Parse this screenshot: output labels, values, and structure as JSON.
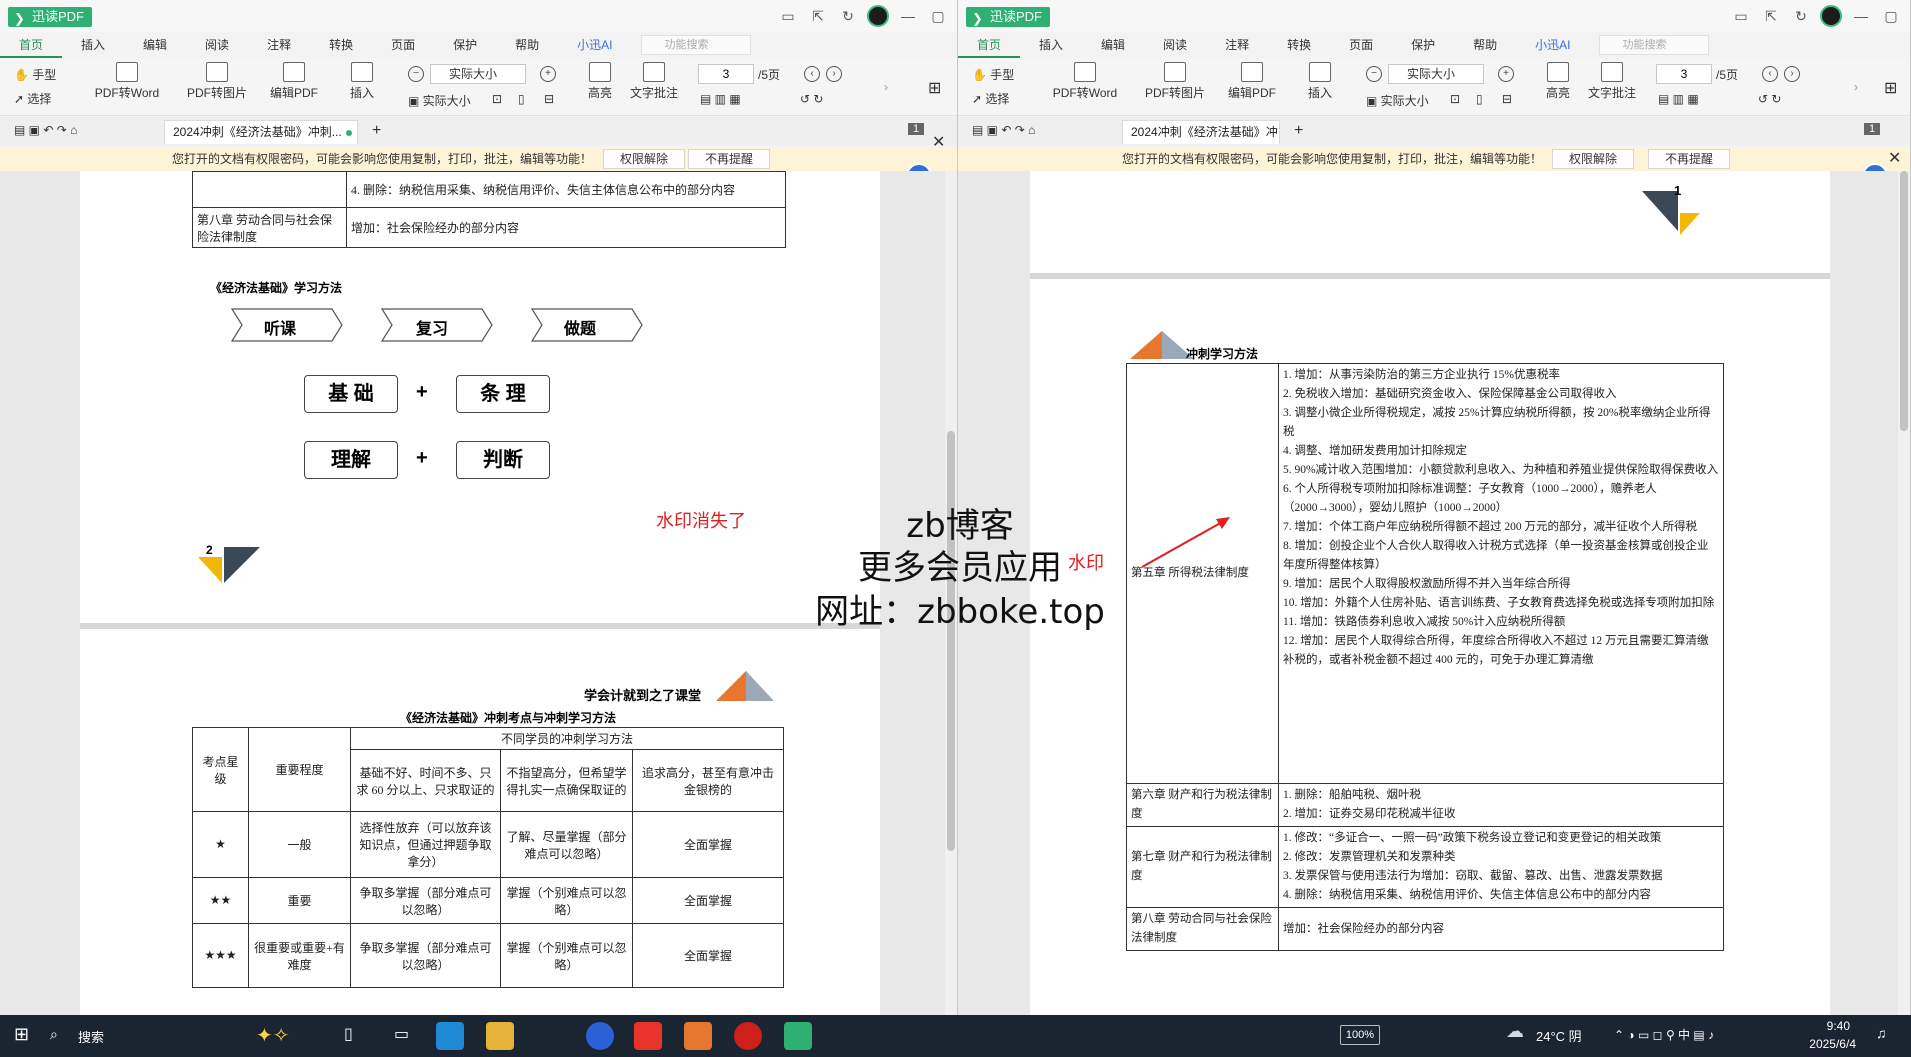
{
  "app": {
    "name": "迅读PDF",
    "menus": [
      "首页",
      "插入",
      "编辑",
      "阅读",
      "注释",
      "转换",
      "页面",
      "保护",
      "帮助",
      "小迅AI"
    ],
    "search_placeholder": "功能搜索"
  },
  "ribbon": {
    "hand": "手型",
    "select": "选择",
    "pdf_to_word": "PDF转Word",
    "pdf_to_image": "PDF转图片",
    "edit_pdf": "编辑PDF",
    "insert": "插入",
    "zoom_value": "实际大小",
    "actual_size": "实际大小",
    "highlight": "高亮",
    "text_annot": "文字批注",
    "page_current": "3",
    "page_total": "/5页"
  },
  "tab": {
    "title": "2024冲刺《经济法基础》冲刺..."
  },
  "notice": {
    "text": "您打开的文档有权限密码，可能会影响您使用复制，打印，批注，编辑等功能！",
    "unlock": "权限解除",
    "dismiss": "不再提醒"
  },
  "left_doc": {
    "chapter8_name": "第八章 劳动合同与社会保险法律制度",
    "chapter8_content": "增加：社会保险经办的部分内容",
    "prev_row_text": "4. 删除：纳税信用采集、纳税信用评价、失信主体信息公布中的部分内容",
    "methods_title": "《经济法基础》学习方法",
    "steps": [
      "听课",
      "复习",
      "做题"
    ],
    "box1a": "基 础",
    "box1b": "条 理",
    "box2a": "理解",
    "box2b": "判断",
    "plus": "+",
    "note": "水印消失了",
    "page_num": "2",
    "brand_line": "学会计就到之了课堂",
    "table_title": "《经济法基础》冲刺考点与冲刺学习方法",
    "table": {
      "h_star": "考点星级",
      "h_importance": "重要程度",
      "h_group": "不同学员的冲刺学习方法",
      "h_col1": "基础不好、时间不多、只求 60 分以上、只求取证的",
      "h_col2": "不指望高分，但希望学得扎实一点确保取证的",
      "h_col3": "追求高分，甚至有意冲击金银榜的",
      "rows": [
        {
          "star": "★",
          "level": "一般",
          "c1": "选择性放弃（可以放弃该知识点，但通过押题争取拿分）",
          "c2": "了解、尽量掌握（部分难点可以忽略）",
          "c3": "全面掌握"
        },
        {
          "star": "★★",
          "level": "重要",
          "c1": "争取多掌握（部分难点可以忽略）",
          "c2": "掌握（个别难点可以忽略）",
          "c3": "全面掌握"
        },
        {
          "star": "★★★",
          "level": "很重要或重要+有难度",
          "c1": "争取多掌握（部分难点可以忽略）",
          "c2": "掌握（个别难点可以忽略）",
          "c3": "全面掌握"
        }
      ]
    }
  },
  "right_doc": {
    "page_num": "1",
    "section_title": "冲刺学习方法",
    "watermark_label": "水印",
    "chapter5_name": "第五章 所得税法律制度",
    "chapter5_items": [
      "1. 增加：从事污染防治的第三方企业执行 15%优惠税率",
      "2. 免税收入增加：基础研究资金收入、保险保障基金公司取得收入",
      "3. 调整小微企业所得税规定，减按 25%计算应纳税所得额，按 20%税率缴纳企业所得税",
      "4. 调整、增加研发费用加计扣除规定",
      "5. 90%减计收入范围增加：小额贷款利息收入、为种植和养殖业提供保险取得保费收入",
      "6. 个人所得税专项附加扣除标准调整：子女教育（1000→2000），赡养老人（2000→3000），婴幼儿照护（1000→2000）",
      "7. 增加：个体工商户年应纳税所得额不超过 200 万元的部分，减半征收个人所得税",
      "8. 增加：创投企业个人合伙人取得收入计税方式选择（单一投资基金核算或创投企业年度所得整体核算）",
      "9. 增加：居民个人取得股权激励所得不并入当年综合所得",
      "10. 增加：外籍个人住房补贴、语言训练费、子女教育费选择免税或选择专项附加扣除",
      "11. 增加：铁路债券利息收入减按 50%计入应纳税所得额",
      "12. 增加：居民个人取得综合所得，年度综合所得收入不超过 12 万元且需要汇算清缴补税的，或者补税金额不超过 400 元的，可免于办理汇算清缴"
    ],
    "chapter6_name": "第六章 财产和行为税法律制度",
    "chapter6_items": [
      "1. 删除：船舶吨税、烟叶税",
      "2. 增加：证券交易印花税减半征收"
    ],
    "chapter7_name": "第七章 财产和行为税法律制度",
    "chapter7_items": [
      "1. 修改：“多证合一、一照一码”政策下税务设立登记和变更登记的相关政策",
      "2. 修改：发票管理机关和发票种类",
      "3. 发票保管与使用违法行为增加：窃取、截留、篡改、出售、泄露发票数据",
      "4. 删除：纳税信用采集、纳税信用评价、失信主体信息公布中的部分内容"
    ],
    "chapter8_name": "第八章 劳动合同与社会保险法律制度",
    "chapter8_content": "增加：社会保险经办的部分内容"
  },
  "overlay": {
    "line1": "zb博客",
    "line2": "更多会员应用",
    "line3": "网址：zbboke.top"
  },
  "taskbar": {
    "search": "搜索",
    "battery": "100%",
    "weather": "24°C 阴",
    "time": "9:40",
    "date": "2025/6/4"
  },
  "colors": {
    "brand_green": "#2db071",
    "note_red": "#e02020",
    "dark_navy": "#3b4858",
    "accent_yellow": "#f2b705",
    "accent_orange": "#e8772e"
  }
}
